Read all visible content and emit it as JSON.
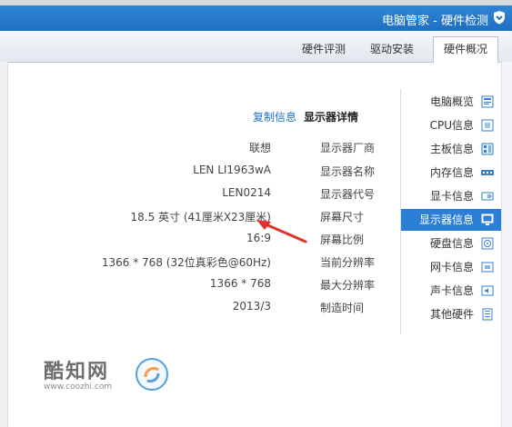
{
  "window": {
    "title": "电脑管家 - 硬件检测"
  },
  "tabs": [
    {
      "label": "硬件概况",
      "active": true
    },
    {
      "label": "驱动安装",
      "active": false
    },
    {
      "label": "硬件评测",
      "active": false
    }
  ],
  "sidebar": {
    "items": [
      {
        "label": "电脑概览",
        "icon": "computer-icon",
        "active": false
      },
      {
        "label": "CPU信息",
        "icon": "cpu-icon",
        "active": false
      },
      {
        "label": "主板信息",
        "icon": "motherboard-icon",
        "active": false
      },
      {
        "label": "内存信息",
        "icon": "memory-icon",
        "active": false
      },
      {
        "label": "显卡信息",
        "icon": "gpu-icon",
        "active": false
      },
      {
        "label": "显示器信息",
        "icon": "monitor-icon",
        "active": true
      },
      {
        "label": "硬盘信息",
        "icon": "disk-icon",
        "active": false
      },
      {
        "label": "网卡信息",
        "icon": "network-icon",
        "active": false
      },
      {
        "label": "声卡信息",
        "icon": "sound-icon",
        "active": false
      },
      {
        "label": "其他硬件",
        "icon": "other-hardware-icon",
        "active": false
      }
    ]
  },
  "detail": {
    "title": "显示器详情",
    "copy_label": "复制信息",
    "rows": [
      {
        "label": "显示器厂商",
        "value": "联想"
      },
      {
        "label": "显示器名称",
        "value": "LEN LI1963wA"
      },
      {
        "label": "显示器代号",
        "value": "LEN0214"
      },
      {
        "label": "屏幕尺寸",
        "value": "18.5 英寸 (41厘米X23厘米)"
      },
      {
        "label": "屏幕比例",
        "value": "16:9"
      },
      {
        "label": "当前分辨率",
        "value": "1366 * 768 (32位真彩色@60Hz)"
      },
      {
        "label": "最大分辨率",
        "value": "1366 * 768"
      },
      {
        "label": "制造时间",
        "value": "2013/3"
      }
    ]
  },
  "watermark": {
    "title": "酷知网",
    "url": "www.coozhi.com"
  },
  "colors": {
    "titlebar": "#1f6fc0",
    "accent": "#2b7fd6",
    "link": "#1a73c8",
    "arrow": "#e0312c"
  }
}
